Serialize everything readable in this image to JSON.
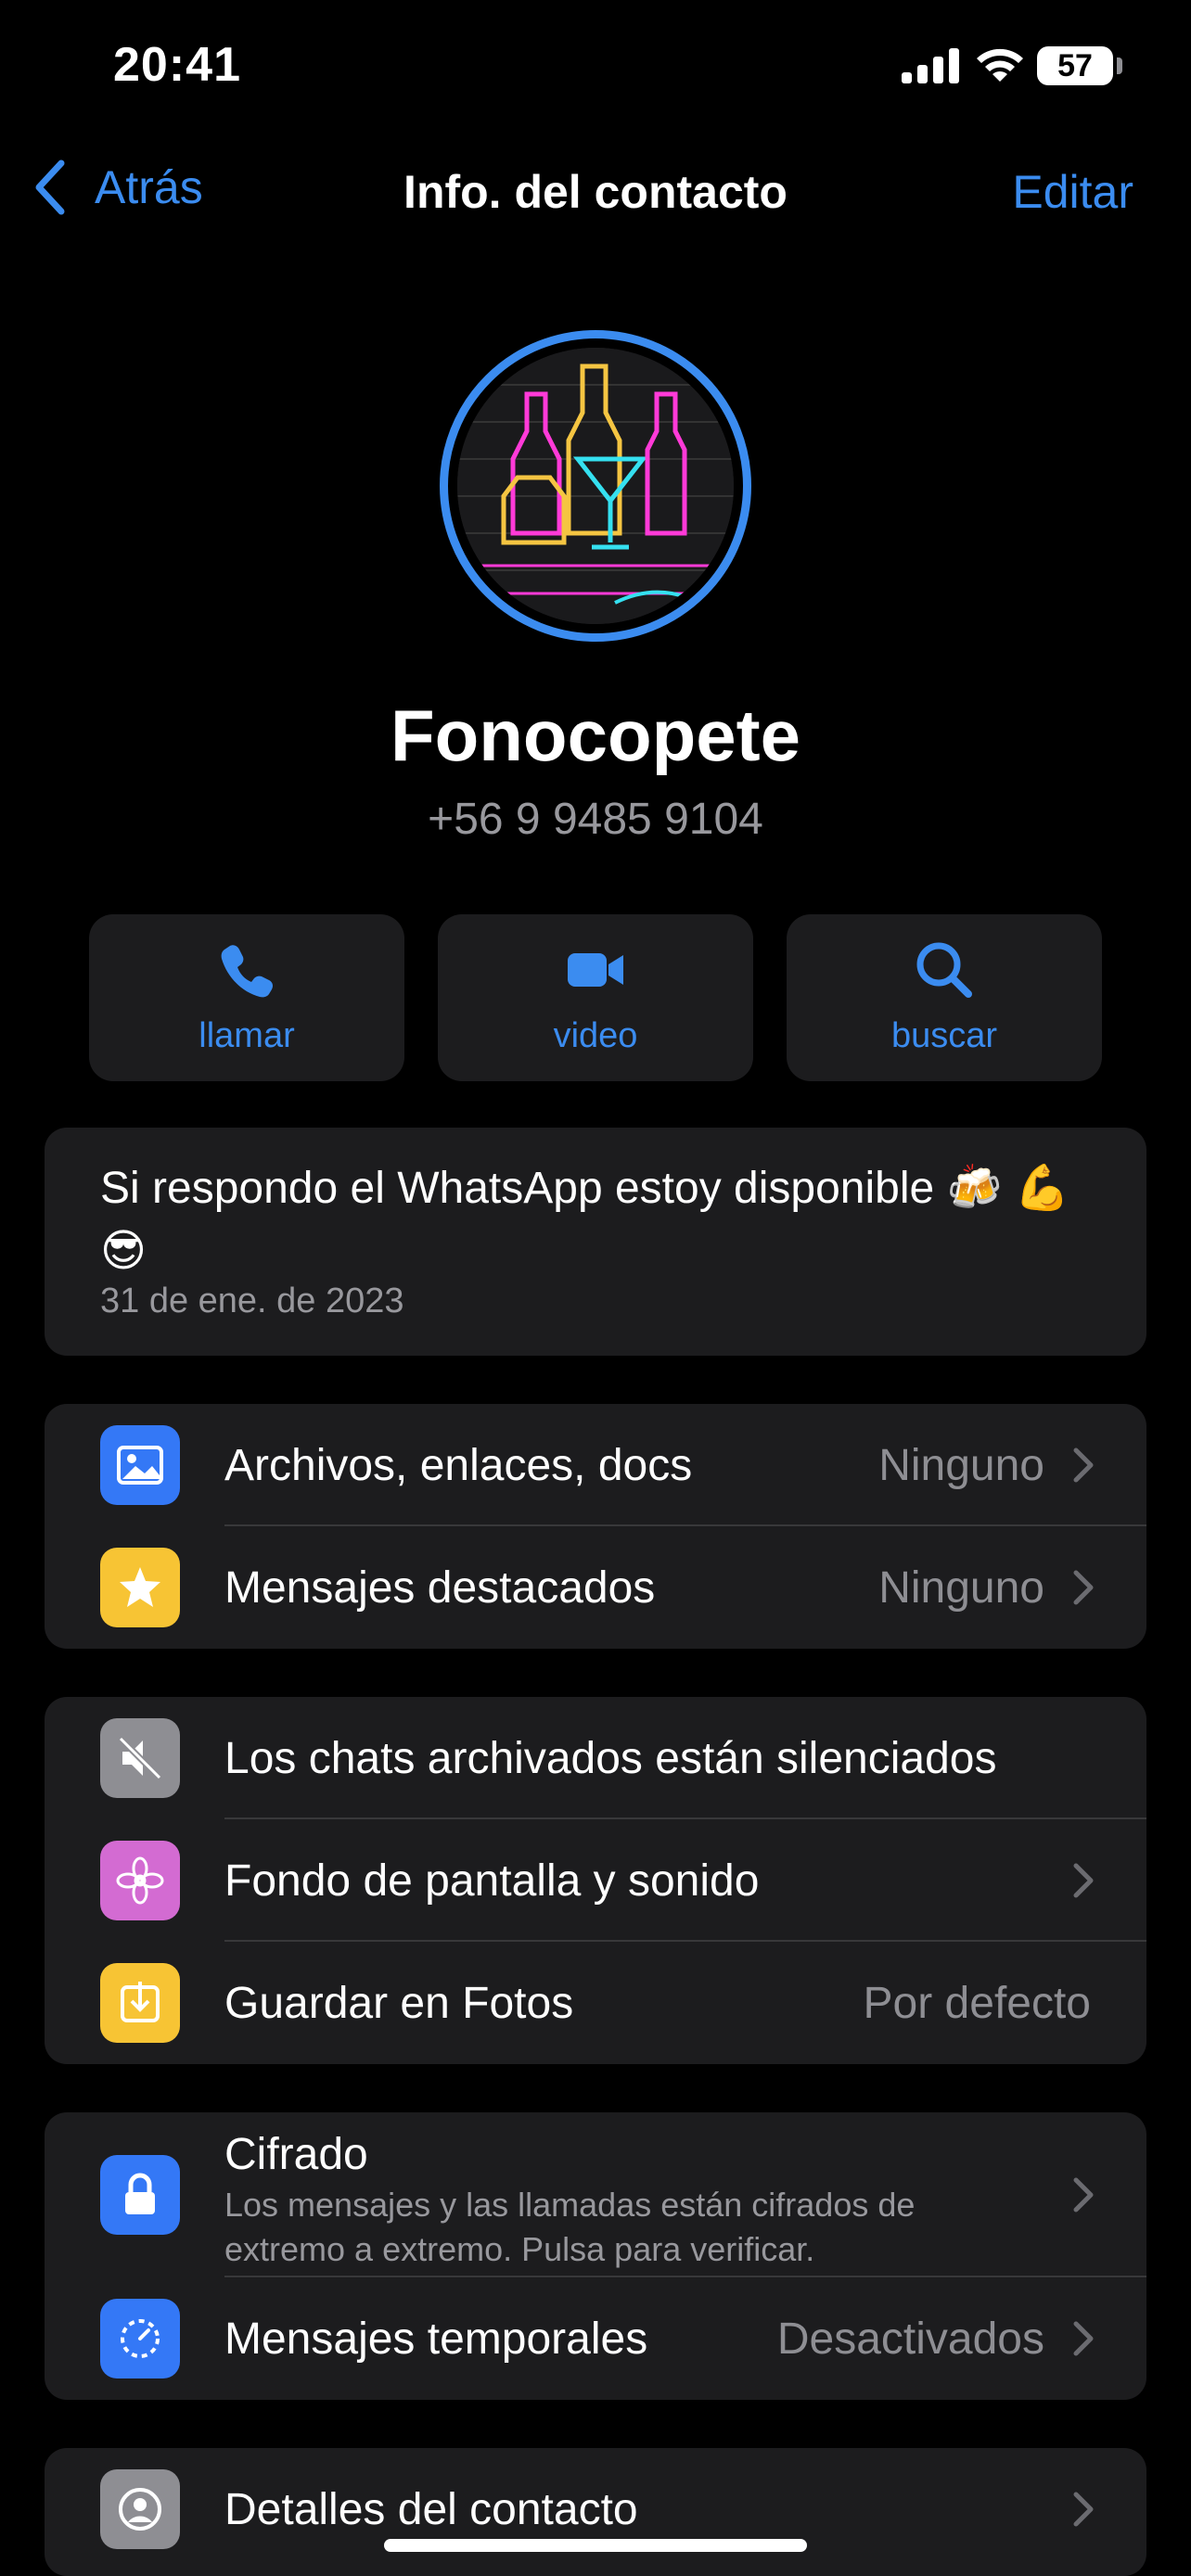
{
  "status_bar": {
    "time": "20:41",
    "battery": "57"
  },
  "nav": {
    "back_label": "Atrás",
    "title": "Info. del contacto",
    "edit_label": "Editar"
  },
  "contact": {
    "name": "Fonocopete",
    "phone": "+56 9 9485 9104"
  },
  "actions": [
    {
      "label": "llamar",
      "icon": "phone-icon"
    },
    {
      "label": "video",
      "icon": "video-icon"
    },
    {
      "label": "buscar",
      "icon": "search-icon"
    }
  ],
  "about": {
    "text": "Si respondo el WhatsApp estoy disponible 🍻 💪😎",
    "date": "31 de ene. de 2023"
  },
  "media_group": [
    {
      "label": "Archivos, enlaces, docs",
      "value": "Ninguno",
      "icon": "photo-icon",
      "color": "#3478f6"
    },
    {
      "label": "Mensajes destacados",
      "value": "Ninguno",
      "icon": "star-icon",
      "color": "#f7c434"
    }
  ],
  "settings_group": [
    {
      "label": "Los chats archivados están silenciados",
      "value": "",
      "icon": "mute-icon",
      "color": "#8e8e93"
    },
    {
      "label": "Fondo de pantalla y sonido",
      "value": "",
      "icon": "flower-icon",
      "color": "#d36bd2"
    },
    {
      "label": "Guardar en Fotos",
      "value": "Por defecto",
      "icon": "download-icon",
      "color": "#f7c434"
    }
  ],
  "privacy_group": [
    {
      "label": "Cifrado",
      "subtitle": "Los mensajes y las llamadas están cifrados de extremo a extremo. Pulsa para verificar.",
      "icon": "lock-icon",
      "color": "#3478f6"
    },
    {
      "label": "Mensajes temporales",
      "value": "Desactivados",
      "icon": "timer-icon",
      "color": "#3478f6"
    }
  ],
  "details_group": [
    {
      "label": "Detalles del contacto",
      "icon": "contact-icon",
      "color": "#8e8e93"
    }
  ]
}
